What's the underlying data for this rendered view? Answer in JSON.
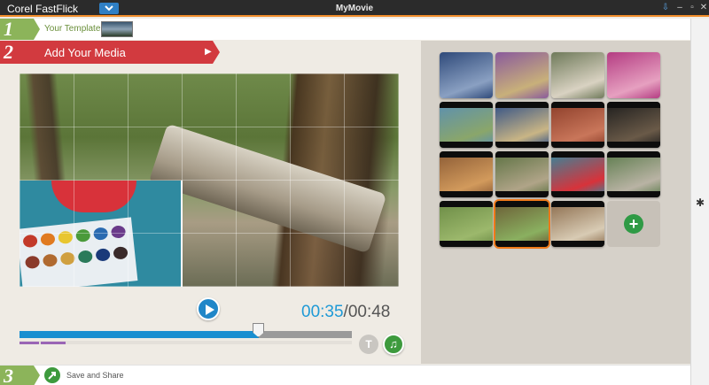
{
  "app": {
    "name": "Corel FastFlick",
    "window_title": "MyMovie"
  },
  "window_controls": [
    "⇩",
    "–",
    "▫",
    "✕"
  ],
  "step1": {
    "number": "1",
    "label": "Your Template:"
  },
  "step2": {
    "number": "2",
    "title": "Add Your Media"
  },
  "step3": {
    "number": "3",
    "label": "Save and Share"
  },
  "player": {
    "current_time": "00:35",
    "separator": "/",
    "total_time": "00:48",
    "progress": 0.72
  },
  "tools": {
    "title_glyph": "T",
    "music_glyph": "♫"
  },
  "library": {
    "add_glyph": "+",
    "thumbnails": [
      {
        "name": "marathon-crowd-1",
        "colors": [
          "#2f4a7a",
          "#8aa0c2"
        ]
      },
      {
        "name": "marathon-crowd-2",
        "colors": [
          "#8a5a9c",
          "#c8b07a"
        ]
      },
      {
        "name": "runner",
        "colors": [
          "#6f7a5a",
          "#d9d2c2"
        ]
      },
      {
        "name": "spectators-pink",
        "colors": [
          "#b43c82",
          "#e6a0c0"
        ]
      },
      {
        "name": "harbor",
        "colors": [
          "#5a8fb4",
          "#8aa66a"
        ]
      },
      {
        "name": "skyscraper",
        "colors": [
          "#2b4c86",
          "#c9b585"
        ]
      },
      {
        "name": "brick-building",
        "colors": [
          "#8a3c28",
          "#c9765a"
        ]
      },
      {
        "name": "street-dark",
        "colors": [
          "#1c1c1c",
          "#6a5a48"
        ]
      },
      {
        "name": "deck-boards",
        "colors": [
          "#8a5a34",
          "#d29a5c"
        ]
      },
      {
        "name": "fallen-tree",
        "colors": [
          "#5a7040",
          "#b0a488"
        ]
      },
      {
        "name": "watercolor-paints",
        "colors": [
          "#2f8aa0",
          "#d8323a"
        ]
      },
      {
        "name": "backyard",
        "colors": [
          "#5a7a4a",
          "#b9b3a4"
        ]
      },
      {
        "name": "garden",
        "colors": [
          "#6a8a44",
          "#9cb86c"
        ]
      },
      {
        "name": "vegetable-bed",
        "colors": [
          "#6a5a34",
          "#8ab060"
        ],
        "selected": true
      },
      {
        "name": "kitchen",
        "colors": [
          "#8a6a4a",
          "#d8cbb4"
        ]
      }
    ]
  }
}
